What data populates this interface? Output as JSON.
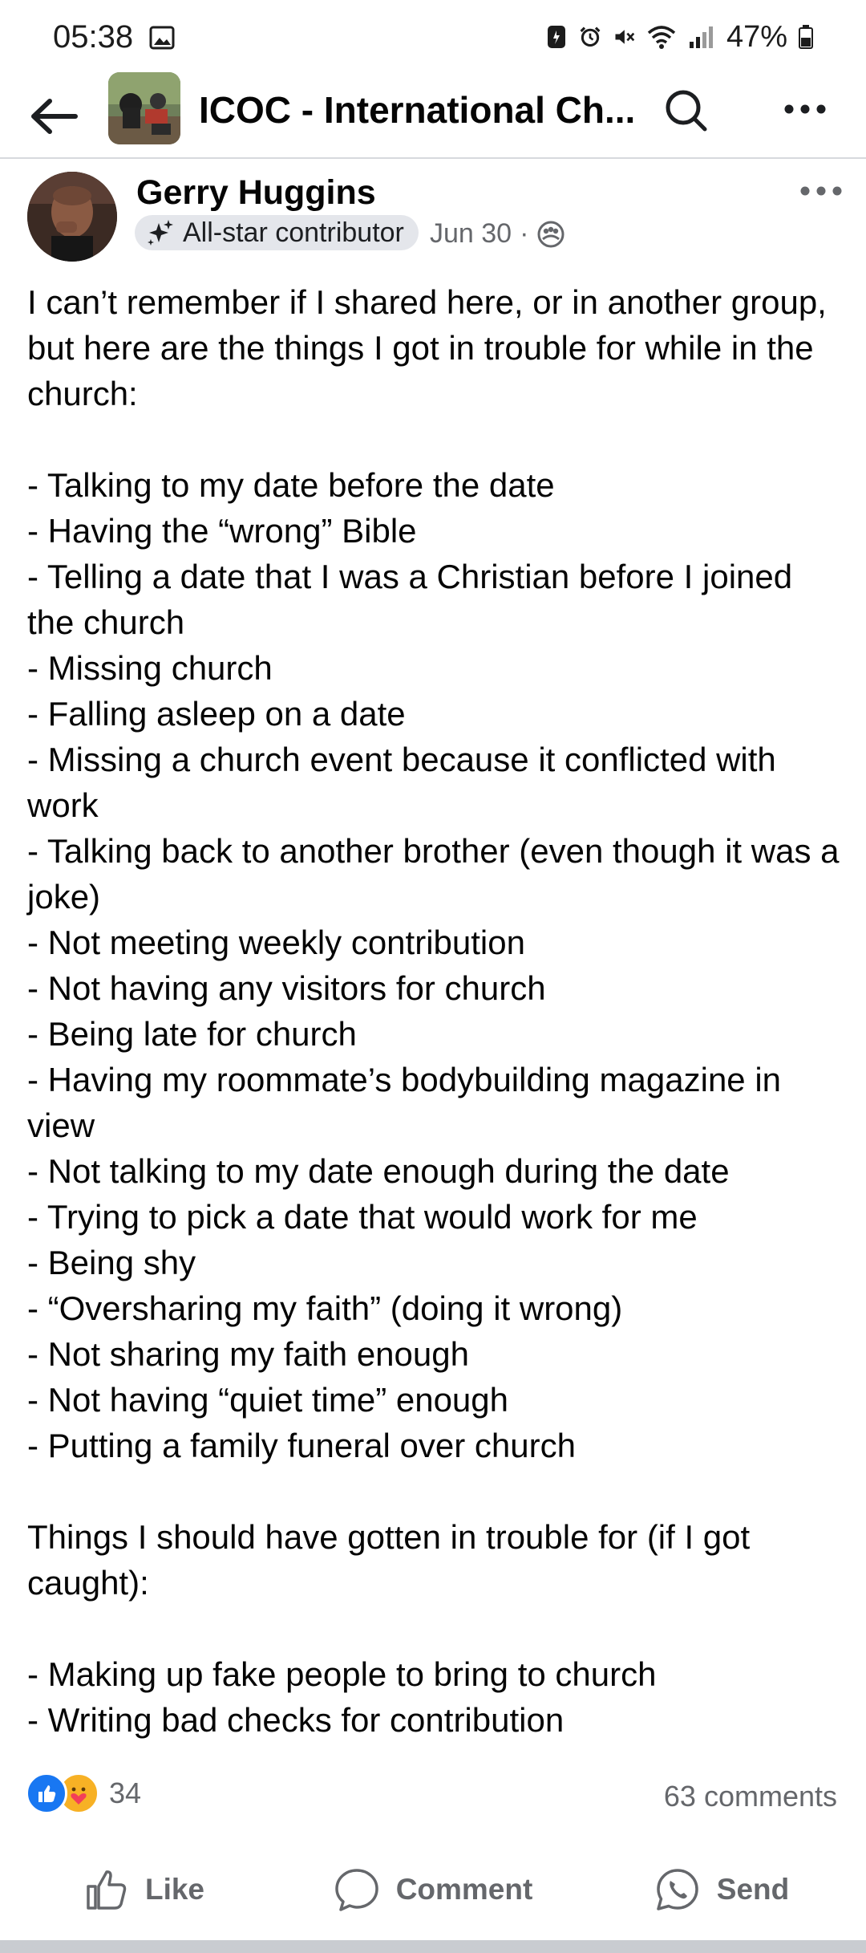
{
  "status_bar": {
    "time": "05:38",
    "battery": "47%",
    "icons": [
      "image-icon",
      "data-saver-icon",
      "alarm-icon",
      "mute-icon",
      "wifi-icon",
      "signal-icon",
      "battery-icon"
    ]
  },
  "top_bar": {
    "group_title": "ICOC - International Ch...",
    "icons": [
      "back-arrow-icon",
      "search-icon",
      "more-icon"
    ]
  },
  "post": {
    "author": "Gerry Huggins",
    "badge": "All-star contributor",
    "date": "Jun 30",
    "separator": "·",
    "privacy_icon": "group-audience-icon",
    "lines": [
      "I can’t remember if I shared here, or in another group, but here are the things I got in trouble for while in the church:",
      "",
      "- Talking to my date before the date",
      "- Having the “wrong” Bible",
      "- Telling a date that I was a Christian before I joined the church",
      "- Missing church",
      "- Falling asleep on a date",
      "- Missing a church event because it conflicted with work",
      "- Talking back to another brother (even though it was a joke)",
      "- Not meeting weekly contribution",
      "- Not having any visitors for church",
      "- Being late for church",
      "- Having my roommate’s bodybuilding magazine in view",
      "- Not talking to my date enough during the date",
      "- Trying to pick a date that would work for me",
      "- Being shy",
      "- “Oversharing my faith” (doing it wrong)",
      "- Not sharing my faith enough",
      "- Not having “quiet time” enough",
      "- Putting a family funeral over church",
      "",
      "Things I should have gotten in trouble for (if I got caught):",
      "",
      "- Making up fake people to bring to church",
      "- Writing bad checks for contribution"
    ],
    "reaction_count": "34",
    "comment_count": "63 comments",
    "reaction_icons": [
      "like-reaction-icon",
      "care-reaction-icon"
    ]
  },
  "actions": {
    "like": "Like",
    "comment": "Comment",
    "send": "Send"
  },
  "colors": {
    "facebook_blue": "#1877f2",
    "secondary_text": "#65676b",
    "badge_bg": "#e4e6eb"
  }
}
